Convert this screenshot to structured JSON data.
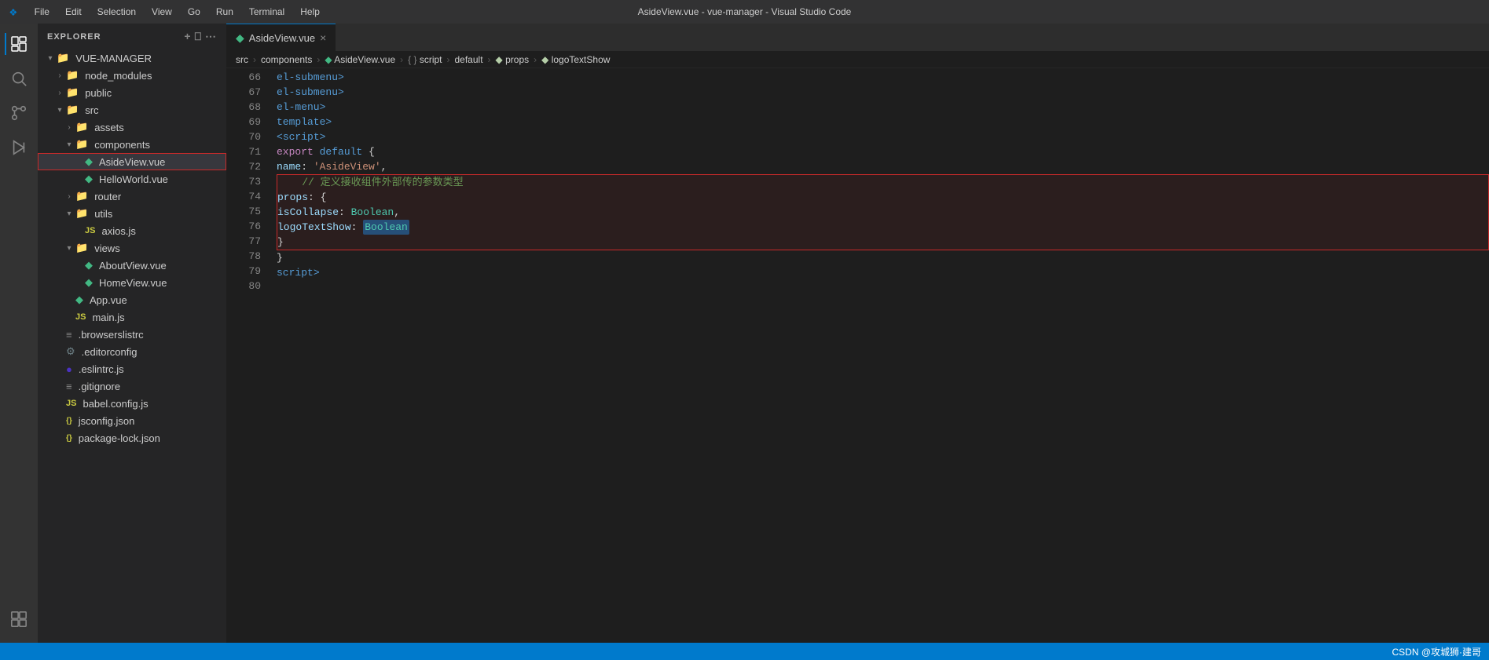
{
  "titleBar": {
    "title": "AsideView.vue - vue-manager - Visual Studio Code",
    "logo": "VS",
    "menus": [
      "File",
      "Edit",
      "Selection",
      "View",
      "Go",
      "Run",
      "Terminal",
      "Help"
    ]
  },
  "activityBar": {
    "icons": [
      {
        "name": "explorer-icon",
        "symbol": "⬜",
        "active": true
      },
      {
        "name": "search-icon",
        "symbol": "🔍",
        "active": false
      },
      {
        "name": "source-control-icon",
        "symbol": "⎇",
        "active": false
      },
      {
        "name": "run-icon",
        "symbol": "▶",
        "active": false
      },
      {
        "name": "extensions-icon",
        "symbol": "⊞",
        "active": false
      }
    ]
  },
  "sidebar": {
    "header": "EXPLORER",
    "projectName": "VUE-MANAGER",
    "tree": [
      {
        "level": 0,
        "type": "folder",
        "label": "VUE-MANAGER",
        "expanded": true,
        "arrow": "▾"
      },
      {
        "level": 1,
        "type": "folder",
        "label": "node_modules",
        "expanded": false,
        "arrow": "›"
      },
      {
        "level": 1,
        "type": "folder",
        "label": "public",
        "expanded": false,
        "arrow": "›"
      },
      {
        "level": 1,
        "type": "folder",
        "label": "src",
        "expanded": true,
        "arrow": "▾"
      },
      {
        "level": 2,
        "type": "folder",
        "label": "assets",
        "expanded": false,
        "arrow": "›"
      },
      {
        "level": 2,
        "type": "folder",
        "label": "components",
        "expanded": true,
        "arrow": "▾"
      },
      {
        "level": 3,
        "type": "vue",
        "label": "AsideView.vue",
        "active": true
      },
      {
        "level": 3,
        "type": "vue",
        "label": "HelloWorld.vue"
      },
      {
        "level": 2,
        "type": "folder",
        "label": "router",
        "expanded": false,
        "arrow": "›"
      },
      {
        "level": 2,
        "type": "folder",
        "label": "utils",
        "expanded": true,
        "arrow": "▾"
      },
      {
        "level": 3,
        "type": "js",
        "label": "axios.js"
      },
      {
        "level": 2,
        "type": "folder",
        "label": "views",
        "expanded": true,
        "arrow": "▾"
      },
      {
        "level": 3,
        "type": "vue",
        "label": "AboutView.vue"
      },
      {
        "level": 3,
        "type": "vue",
        "label": "HomeView.vue"
      },
      {
        "level": 2,
        "type": "vue",
        "label": "App.vue"
      },
      {
        "level": 2,
        "type": "js",
        "label": "main.js"
      },
      {
        "level": 1,
        "type": "text",
        "label": ".browserslistrc"
      },
      {
        "level": 1,
        "type": "config",
        "label": ".editorconfig"
      },
      {
        "level": 1,
        "type": "eslint",
        "label": ".eslintrc.js"
      },
      {
        "level": 1,
        "type": "git",
        "label": ".gitignore"
      },
      {
        "level": 1,
        "type": "js",
        "label": "babel.config.js"
      },
      {
        "level": 1,
        "type": "json",
        "label": "jsconfig.json"
      },
      {
        "level": 1,
        "type": "json",
        "label": "package-lock.json"
      }
    ]
  },
  "tab": {
    "label": "AsideView.vue",
    "icon": "vue"
  },
  "breadcrumb": {
    "items": [
      "src",
      "components",
      "AsideView.vue",
      "{ } script",
      "default",
      "props",
      "logoTextShow"
    ]
  },
  "editor": {
    "lines": [
      {
        "num": 66,
        "tokens": [
          {
            "t": "indent8",
            "text": "        "
          },
          {
            "t": "tag",
            "text": "</"
          },
          {
            "t": "tag",
            "text": "el-submenu"
          },
          {
            "t": "tag",
            "text": ">"
          }
        ]
      },
      {
        "num": 67,
        "tokens": [
          {
            "t": "indent4",
            "text": "    "
          },
          {
            "t": "tag",
            "text": "</"
          },
          {
            "t": "tag",
            "text": "el-submenu"
          },
          {
            "t": "tag",
            "text": ">"
          }
        ]
      },
      {
        "num": 68,
        "tokens": [
          {
            "t": "indent4",
            "text": "    "
          },
          {
            "t": "tag",
            "text": "</"
          },
          {
            "t": "tag",
            "text": "el-menu"
          },
          {
            "t": "tag",
            "text": ">"
          }
        ]
      },
      {
        "num": 69,
        "tokens": [
          {
            "t": "tag",
            "text": "</"
          },
          {
            "t": "tag",
            "text": "template"
          },
          {
            "t": "tag",
            "text": ">"
          }
        ]
      },
      {
        "num": 70,
        "tokens": [
          {
            "t": "tag",
            "text": "<"
          },
          {
            "t": "tag",
            "text": "script"
          },
          {
            "t": "tag",
            "text": ">"
          }
        ]
      },
      {
        "num": 71,
        "tokens": [
          {
            "t": "export",
            "text": "export"
          },
          {
            "t": "text",
            "text": " "
          },
          {
            "t": "keyword",
            "text": "default"
          },
          {
            "t": "text",
            "text": " {"
          }
        ]
      },
      {
        "num": 72,
        "tokens": [
          {
            "t": "indent",
            "text": "    "
          },
          {
            "t": "property",
            "text": "name"
          },
          {
            "t": "text",
            "text": ": "
          },
          {
            "t": "string",
            "text": "'AsideView'"
          },
          {
            "t": "text",
            "text": ","
          }
        ]
      },
      {
        "num": 73,
        "tokens": [
          {
            "t": "comment",
            "text": "    // 定义接收组件外部传的参数类型"
          },
          {
            "t": "highlight",
            "text": ""
          }
        ],
        "highlighted": true
      },
      {
        "num": 74,
        "tokens": [
          {
            "t": "indent",
            "text": "    "
          },
          {
            "t": "property",
            "text": "props"
          },
          {
            "t": "text",
            "text": ": {"
          },
          {
            "t": "highlight",
            "text": ""
          }
        ],
        "highlighted": true
      },
      {
        "num": 75,
        "tokens": [
          {
            "t": "indent2",
            "text": "        "
          },
          {
            "t": "property",
            "text": "isCollapse"
          },
          {
            "t": "text",
            "text": ": "
          },
          {
            "t": "type",
            "text": "Boolean"
          },
          {
            "t": "text",
            "text": ","
          },
          {
            "t": "highlight",
            "text": ""
          }
        ],
        "highlighted": true
      },
      {
        "num": 76,
        "tokens": [
          {
            "t": "indent2",
            "text": "        "
          },
          {
            "t": "property",
            "text": "logoTextShow"
          },
          {
            "t": "text",
            "text": ": "
          },
          {
            "t": "type-sel",
            "text": "Boolean"
          },
          {
            "t": "highlight",
            "text": ""
          }
        ],
        "highlighted": true
      },
      {
        "num": 77,
        "tokens": [
          {
            "t": "indent",
            "text": "    "
          },
          {
            "t": "text",
            "text": "}"
          },
          {
            "t": "highlight",
            "text": ""
          }
        ],
        "highlighted": true
      },
      {
        "num": 78,
        "tokens": [
          {
            "t": "text",
            "text": "}"
          }
        ]
      },
      {
        "num": 79,
        "tokens": [
          {
            "t": "tag",
            "text": "</"
          },
          {
            "t": "tag",
            "text": "script"
          },
          {
            "t": "tag",
            "text": ">"
          }
        ]
      },
      {
        "num": 80,
        "tokens": []
      }
    ]
  },
  "statusBar": {
    "left": [],
    "right": "CSDN @攻城狮·建哥"
  }
}
